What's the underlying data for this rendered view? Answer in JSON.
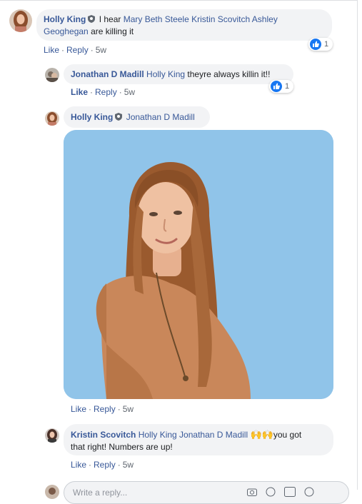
{
  "comments": [
    {
      "author": "Holly King",
      "text_prefix": "I hear",
      "tags": "Mary Beth Steele Kristin Scovitch Ashley",
      "tags_line2": "Geoghegan",
      "text_suffix": "are killing it",
      "actions": {
        "like": "Like",
        "reply": "Reply",
        "time": "5w"
      },
      "reactions": "1"
    },
    {
      "author": "Jonathan D Madill",
      "tag": "Holly King",
      "text": "theyre always killin it!!",
      "actions": {
        "like": "Like",
        "reply": "Reply",
        "time": "5w"
      },
      "reactions": "1"
    },
    {
      "author": "Holly King",
      "tag": "Jonathan D Madill",
      "actions": {
        "like": "Like",
        "reply": "Reply",
        "time": "5w"
      }
    },
    {
      "author": "Kristin Scovitch",
      "tags": "Holly King Jonathan D Madill",
      "emoji": "🙌🙌",
      "text_line1": "you got",
      "text_line2": "that right! Numbers are up!",
      "actions": {
        "like": "Like",
        "reply": "Reply",
        "time": "5w"
      }
    }
  ],
  "composer": {
    "placeholder": "Write a reply..."
  },
  "colors": {
    "link": "#385898",
    "bubble": "#f2f3f5",
    "like_blue": "#1877f2",
    "gif_bg": "#90c4e9"
  }
}
